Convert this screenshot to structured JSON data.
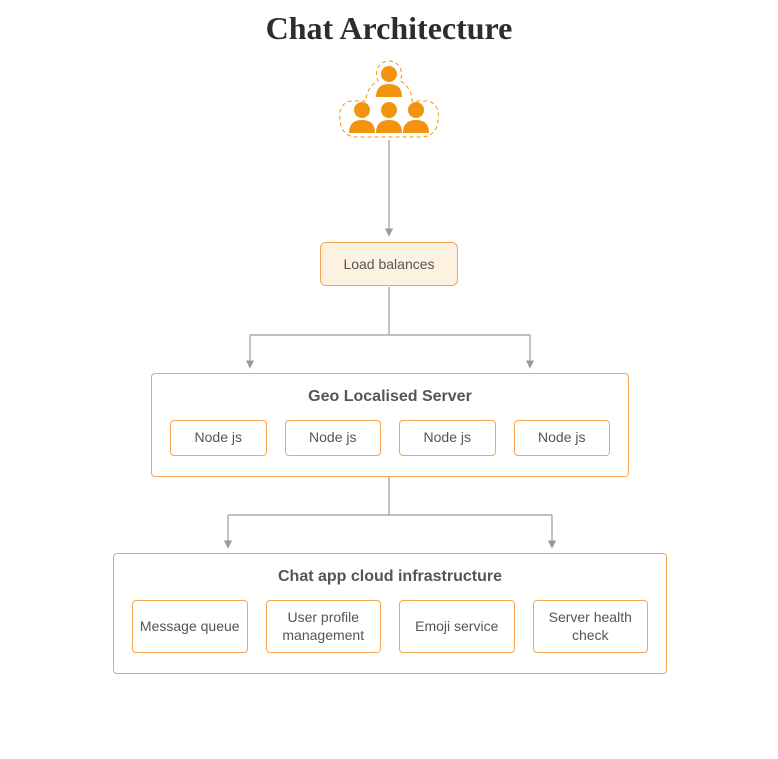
{
  "title": "Chat Architecture",
  "users_icon_name": "users-icon",
  "load_balancer": {
    "label": "Load balances"
  },
  "geo_server": {
    "title": "Geo Localised Server",
    "nodes": [
      "Node js",
      "Node js",
      "Node js",
      "Node js"
    ]
  },
  "infrastructure": {
    "title": "Chat app cloud infrastructure",
    "services": [
      "Message queue",
      "User profile management",
      "Emoji service",
      "Server health check"
    ]
  },
  "colors": {
    "accent": "#f5a650",
    "accent_fill": "#fdf1e2",
    "icon": "#f2940f",
    "arrow": "#9b9b9b",
    "text": "#555555"
  }
}
